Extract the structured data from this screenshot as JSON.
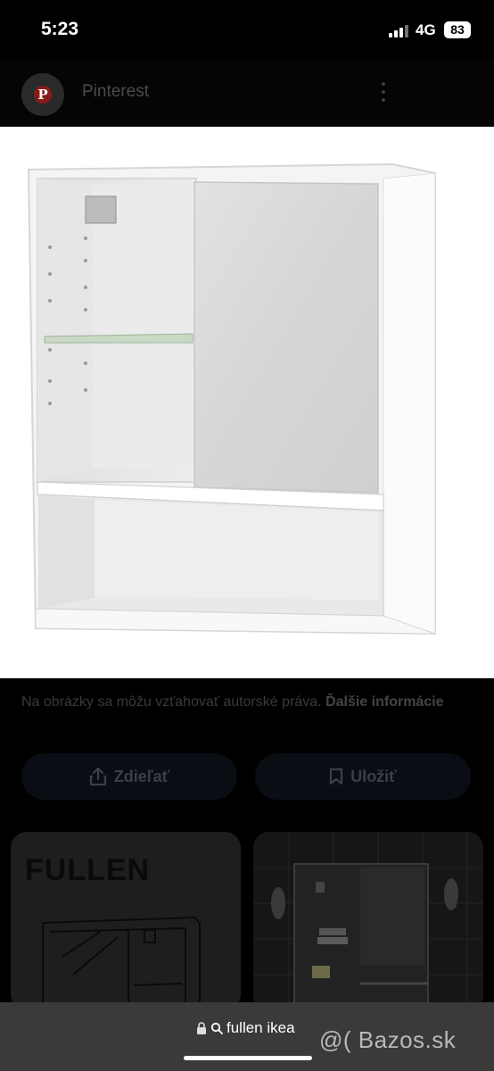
{
  "status_bar": {
    "time": "5:23",
    "network": "4G",
    "battery": "83"
  },
  "header": {
    "site_name": "Pinterest",
    "logo_letter": "P"
  },
  "product_image": {
    "icon": "wall-cabinet-image"
  },
  "copyright": {
    "text": "Na obrázky sa môžu vzťahovať autorské práva.",
    "link": "Ďalšie informácie"
  },
  "actions": {
    "share_label": "Zdieľať",
    "save_label": "Uložiť"
  },
  "results": [
    {
      "title": "FULLEN"
    },
    {
      "title": ""
    }
  ],
  "browser": {
    "url": "fullen ikea"
  },
  "watermark": {
    "text": "@( Bazos.sk"
  }
}
